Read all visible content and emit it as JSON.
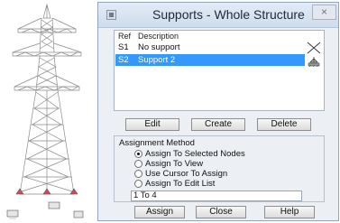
{
  "window": {
    "title": "Supports - Whole Structure",
    "close_glyph": "×"
  },
  "list": {
    "headers": {
      "ref": "Ref",
      "description": "Description"
    },
    "rows": [
      {
        "ref": "S1",
        "description": "No support",
        "selected": false
      },
      {
        "ref": "S2",
        "description": "Support 2",
        "selected": true
      }
    ],
    "side_icons": [
      "no-support-icon",
      "fixed-support-icon"
    ]
  },
  "buttons": {
    "edit": "Edit",
    "create": "Create",
    "delete": "Delete",
    "assign": "Assign",
    "close": "Close",
    "help": "Help"
  },
  "assignment": {
    "label": "Assignment Method",
    "options": [
      {
        "label": "Assign To Selected Nodes",
        "checked": true
      },
      {
        "label": "Assign To View",
        "checked": false
      },
      {
        "label": "Use Cursor To Assign",
        "checked": false
      },
      {
        "label": "Assign To Edit List",
        "checked": false
      }
    ],
    "edit_list_value": "1 To 4"
  },
  "colors": {
    "selection": "#3399ff",
    "dialog_bg": "#ecf0f5",
    "title_bar": "#d9e4f1"
  }
}
